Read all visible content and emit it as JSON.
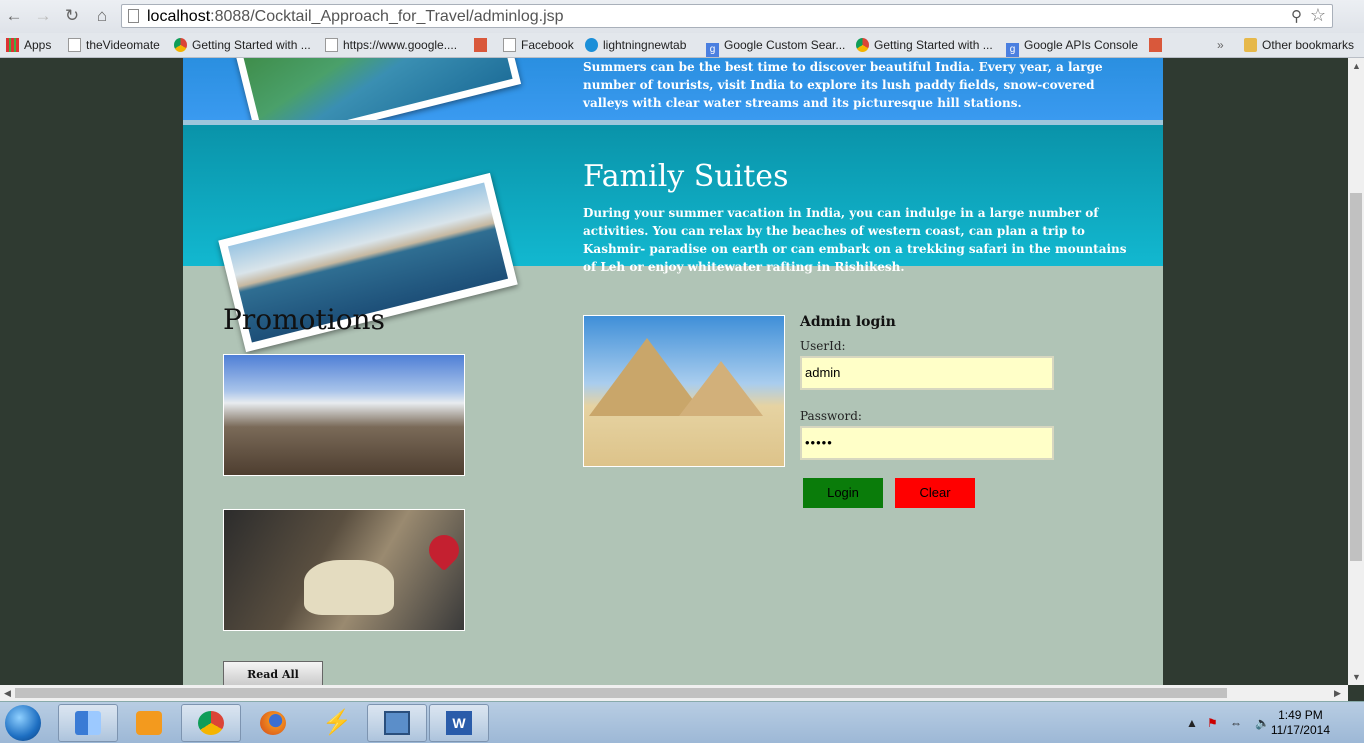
{
  "browser": {
    "url_host": "localhost",
    "url_rest": ":8088/Cocktail_Approach_for_Travel/adminlog.jsp",
    "bookmarks": [
      {
        "label": "Apps",
        "icon": "apps-icon"
      },
      {
        "label": "theVideomate",
        "icon": "page-icon"
      },
      {
        "label": "Getting Started with ...",
        "icon": "chrome-icon"
      },
      {
        "label": "https://www.google....",
        "icon": "page-icon"
      },
      {
        "label": "",
        "icon": "red-page-icon"
      },
      {
        "label": "Facebook",
        "icon": "page-icon"
      },
      {
        "label": "lightningnewtab",
        "icon": "lightning-icon"
      },
      {
        "label": "Google Custom Sear...",
        "icon": "google-icon"
      },
      {
        "label": "Getting Started with ...",
        "icon": "chrome-icon"
      },
      {
        "label": "Google APIs Console",
        "icon": "google-icon"
      },
      {
        "label": "",
        "icon": "red-page-icon"
      }
    ],
    "more_bookmarks": "»",
    "other_bookmarks": "Other bookmarks"
  },
  "banner1": {
    "text": "Summers can be the best time to discover beautiful India. Every year, a large number of tourists, visit India to explore its lush paddy fields, snow-covered valleys with clear water streams and its picturesque hill stations."
  },
  "banner2": {
    "title": "Family Suites",
    "text": "During your summer vacation in India, you can indulge in a large number of activities. You can relax by the beaches of western coast, can plan a trip to Kashmir- paradise on earth or can embark on a trekking safari in the mountains of Leh or enjoy whitewater rafting in Rishikesh."
  },
  "promotions": {
    "title": "Promotions",
    "read_all": "Read All"
  },
  "login": {
    "title": "Admin login",
    "userid_label": "UserId:",
    "userid_value": "admin",
    "password_label": "Password:",
    "password_value": "•••••",
    "login_button": "Login",
    "clear_button": "Clear",
    "login_color": "#0a7c0a",
    "clear_color": "#ff0000"
  },
  "taskbar": {
    "time": "1:49 PM",
    "date": "11/17/2014"
  }
}
